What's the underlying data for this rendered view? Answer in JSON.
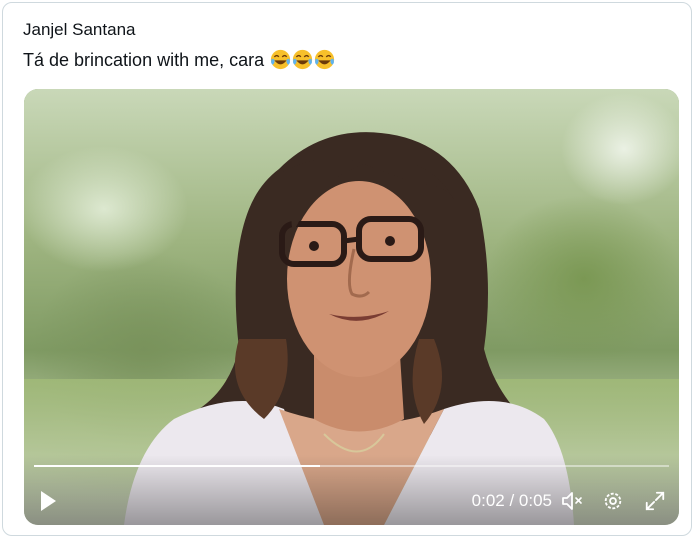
{
  "tweet": {
    "author": "Janjel Santana",
    "text": "Tá de brincation with me, cara",
    "emojis": [
      "😂",
      "😂",
      "😂"
    ]
  },
  "video": {
    "current_time": "0:02",
    "duration": "0:05",
    "time_display": "0:02 / 0:05",
    "progress": 0.45,
    "icons": {
      "play": "play-icon",
      "mute": "volume-muted-icon",
      "settings": "gear-icon",
      "fullscreen": "fullscreen-expand-icon"
    }
  },
  "colors": {
    "text": "#0f1419",
    "border": "#cfd9de",
    "control": "#ffffff"
  }
}
